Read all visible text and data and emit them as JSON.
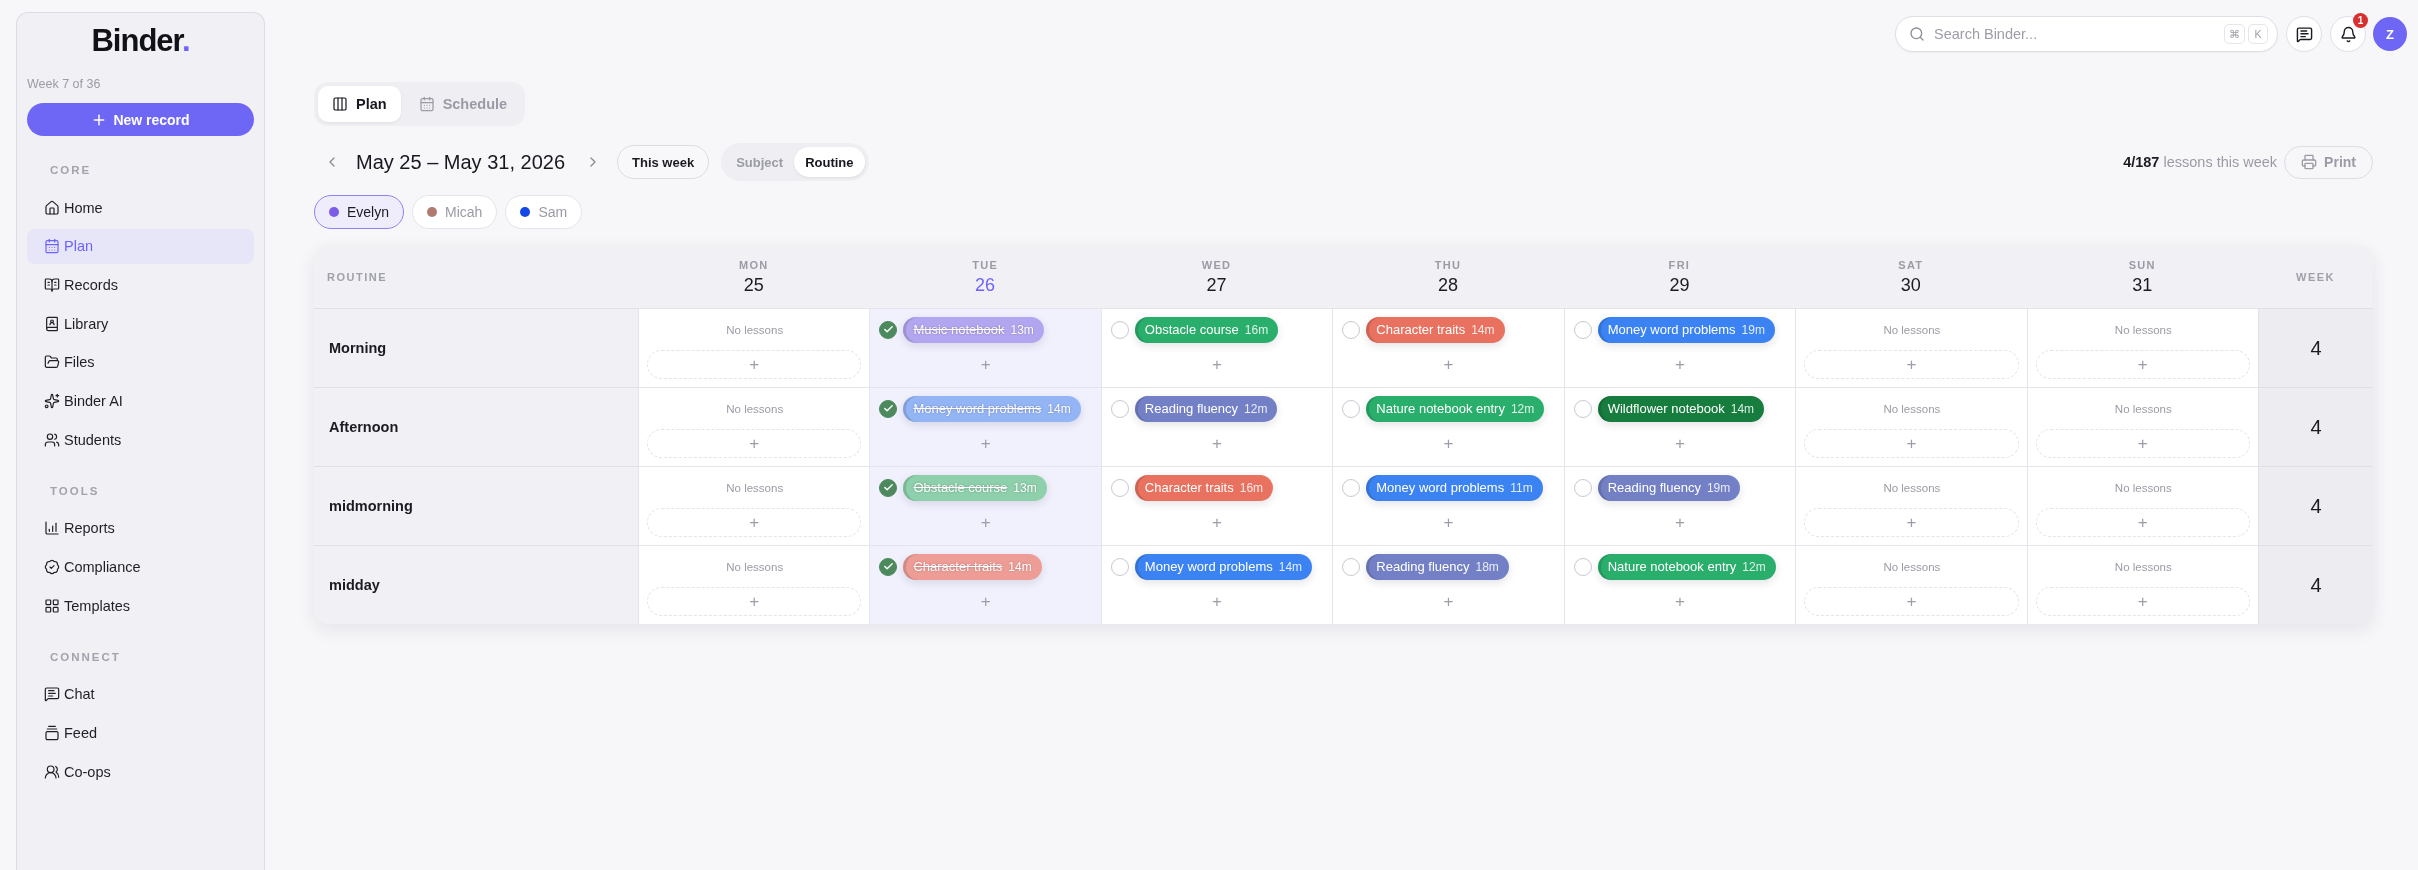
{
  "sidebar": {
    "logo": {
      "name": "Binder",
      "dot": "."
    },
    "week_label": "Week 7 of 36",
    "new_button": "New record",
    "sections": [
      {
        "heading": "CORE",
        "items": [
          {
            "label": "Home",
            "selected": false
          },
          {
            "label": "Plan",
            "selected": true
          },
          {
            "label": "Records",
            "selected": false
          },
          {
            "label": "Library",
            "selected": false
          },
          {
            "label": "Files",
            "selected": false
          },
          {
            "label": "Binder AI",
            "selected": false
          },
          {
            "label": "Students",
            "selected": false
          }
        ]
      },
      {
        "heading": "TOOLS",
        "items": [
          {
            "label": "Reports",
            "selected": false
          },
          {
            "label": "Compliance",
            "selected": false
          },
          {
            "label": "Templates",
            "selected": false
          }
        ]
      },
      {
        "heading": "CONNECT",
        "items": [
          {
            "label": "Chat",
            "selected": false
          },
          {
            "label": "Feed",
            "selected": false
          },
          {
            "label": "Co-ops",
            "selected": false
          }
        ]
      }
    ]
  },
  "topbar": {
    "search": {
      "placeholder": "Search Binder...",
      "keys": [
        "⌘",
        "K"
      ]
    },
    "notification_count": "1",
    "avatar": "Z"
  },
  "view_tabs": [
    {
      "label": "Plan",
      "selected": true
    },
    {
      "label": "Schedule",
      "selected": false
    }
  ],
  "date_nav": {
    "range": "May 25 – May 31, 2026",
    "this_week": "This week"
  },
  "group_by": [
    {
      "label": "Subject",
      "selected": false
    },
    {
      "label": "Routine",
      "selected": true
    }
  ],
  "summary": "**4/187** lessons this week",
  "print_button": "Print",
  "students": [
    {
      "name": "Evelyn",
      "selected": true,
      "color": "#7b5ce6"
    },
    {
      "name": "Micah",
      "selected": false,
      "color": "#b07a70"
    },
    {
      "name": "Sam",
      "selected": false,
      "color": "#1547e6"
    }
  ],
  "calendar": {
    "corner": "ROUTINE",
    "total_heading": "WEEK",
    "days": [
      {
        "name": "MON",
        "date": "25",
        "today": false
      },
      {
        "name": "TUE",
        "date": "26",
        "today": true
      },
      {
        "name": "WED",
        "date": "27",
        "today": false
      },
      {
        "name": "THU",
        "date": "28",
        "today": false
      },
      {
        "name": "FRI",
        "date": "29",
        "today": false
      },
      {
        "name": "SAT",
        "date": "30",
        "today": false
      },
      {
        "name": "SUN",
        "date": "31",
        "today": false
      }
    ],
    "rows": [
      {
        "label": "Morning",
        "total": "4",
        "cells": [
          {
            "empty_text": "No lessons",
            "add": "+"
          },
          {
            "lessons": [
              {
                "title": "Music notebook",
                "duration": "13m",
                "color": "#b3a6f0",
                "done": true
              }
            ],
            "add": "+"
          },
          {
            "lessons": [
              {
                "title": "Obstacle course",
                "duration": "16m",
                "color": "#29ae6c",
                "done": false
              }
            ],
            "add": "+"
          },
          {
            "lessons": [
              {
                "title": "Character traits",
                "duration": "14m",
                "color": "#e8715f",
                "done": false
              }
            ],
            "add": "+"
          },
          {
            "lessons": [
              {
                "title": "Money word problems",
                "duration": "19m",
                "color": "#3b82f3",
                "done": false
              }
            ],
            "add": "+"
          },
          {
            "empty_text": "No lessons",
            "add": "+"
          },
          {
            "empty_text": "No lessons",
            "add": "+"
          }
        ]
      },
      {
        "label": "Afternoon",
        "total": "4",
        "cells": [
          {
            "empty_text": "No lessons",
            "add": "+"
          },
          {
            "lessons": [
              {
                "title": "Money word problems",
                "duration": "14m",
                "color": "#93b5f5",
                "done": true
              }
            ],
            "add": "+"
          },
          {
            "lessons": [
              {
                "title": "Reading fluency",
                "duration": "12m",
                "color": "#7480c6",
                "done": false
              }
            ],
            "add": "+"
          },
          {
            "lessons": [
              {
                "title": "Nature notebook entry",
                "duration": "12m",
                "color": "#29ae6c",
                "done": false
              }
            ],
            "add": "+"
          },
          {
            "lessons": [
              {
                "title": "Wildflower notebook",
                "duration": "14m",
                "color": "#167d3e",
                "done": false
              }
            ],
            "add": "+"
          },
          {
            "empty_text": "No lessons",
            "add": "+"
          },
          {
            "empty_text": "No lessons",
            "add": "+"
          }
        ]
      },
      {
        "label": "midmorning",
        "total": "4",
        "cells": [
          {
            "empty_text": "No lessons",
            "add": "+"
          },
          {
            "lessons": [
              {
                "title": "Obstacle course",
                "duration": "13m",
                "color": "#8dd0ab",
                "done": true
              }
            ],
            "add": "+"
          },
          {
            "lessons": [
              {
                "title": "Character traits",
                "duration": "16m",
                "color": "#e8715f",
                "done": false
              }
            ],
            "add": "+"
          },
          {
            "lessons": [
              {
                "title": "Money word problems",
                "duration": "11m",
                "color": "#3b82f3",
                "done": false
              }
            ],
            "add": "+"
          },
          {
            "lessons": [
              {
                "title": "Reading fluency",
                "duration": "19m",
                "color": "#7480c6",
                "done": false
              }
            ],
            "add": "+"
          },
          {
            "empty_text": "No lessons",
            "add": "+"
          },
          {
            "empty_text": "No lessons",
            "add": "+"
          }
        ]
      },
      {
        "label": "midday",
        "total": "4",
        "cells": [
          {
            "empty_text": "No lessons",
            "add": "+"
          },
          {
            "lessons": [
              {
                "title": "Character traits",
                "duration": "14m",
                "color": "#ee9d96",
                "done": true
              }
            ],
            "add": "+"
          },
          {
            "lessons": [
              {
                "title": "Money word problems",
                "duration": "14m",
                "color": "#3b82f3",
                "done": false
              }
            ],
            "add": "+"
          },
          {
            "lessons": [
              {
                "title": "Reading fluency",
                "duration": "18m",
                "color": "#7480c6",
                "done": false
              }
            ],
            "add": "+"
          },
          {
            "lessons": [
              {
                "title": "Nature notebook entry",
                "duration": "12m",
                "color": "#29ae6c",
                "done": false
              }
            ],
            "add": "+"
          },
          {
            "empty_text": "No lessons",
            "add": "+"
          },
          {
            "empty_text": "No lessons",
            "add": "+"
          }
        ]
      }
    ]
  }
}
